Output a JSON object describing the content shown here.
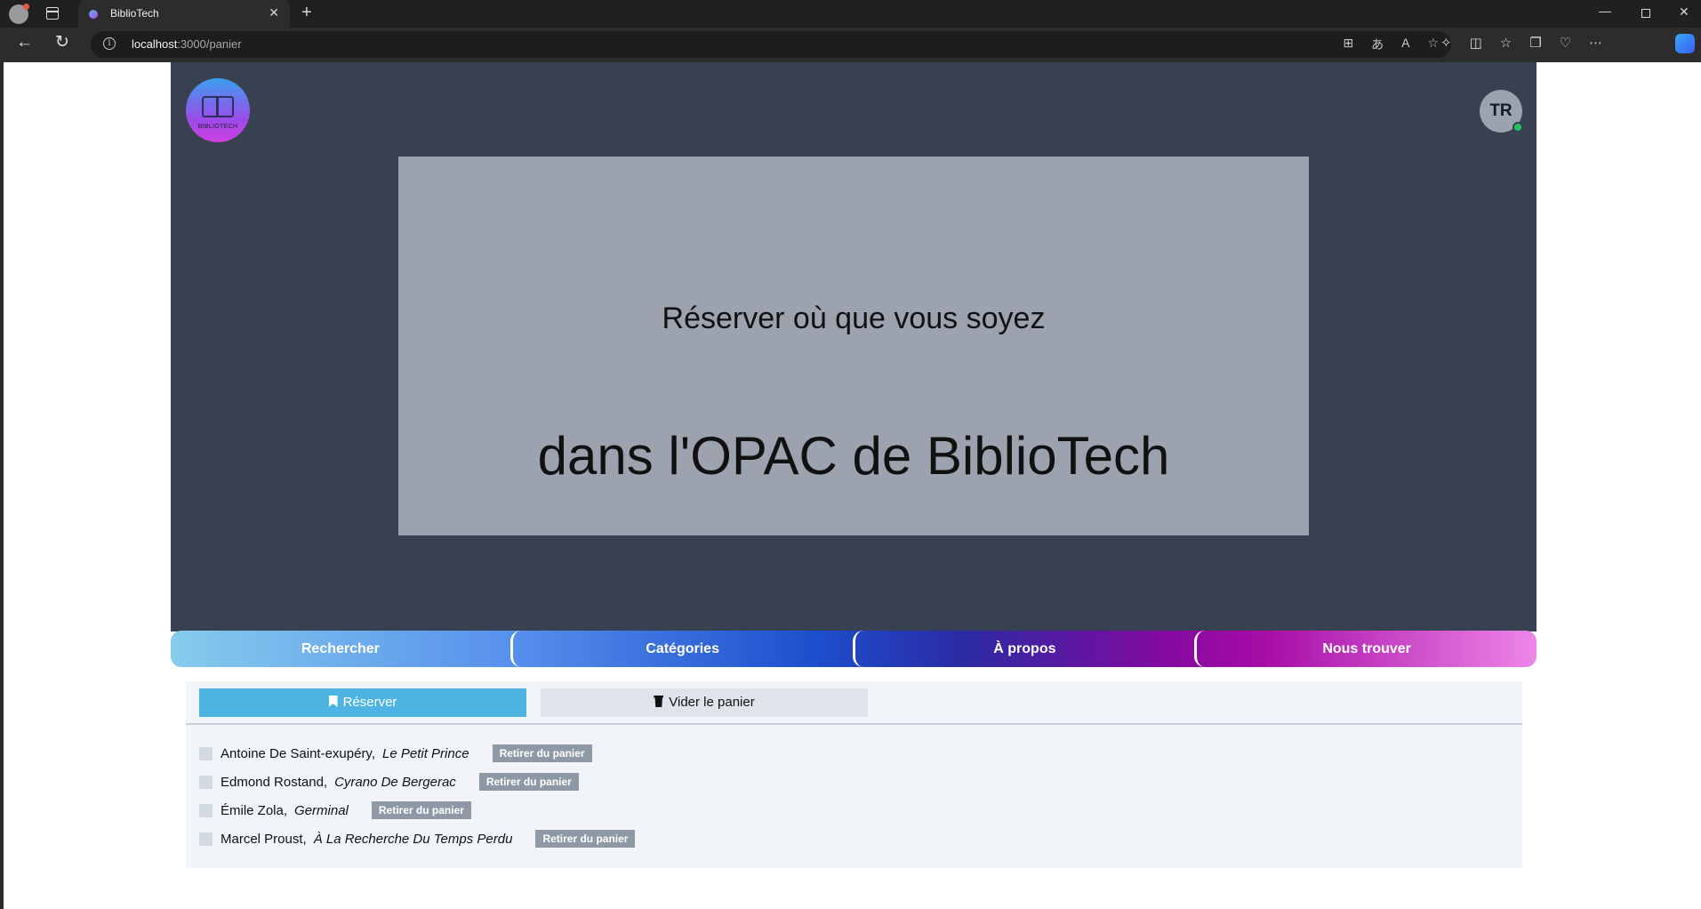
{
  "browser": {
    "tab_title": "BiblioTech",
    "url_host": "localhost",
    "url_path": ":3000/panier"
  },
  "header": {
    "logo_text": "BIBLIOTECH",
    "user_initials": "TR"
  },
  "banner": {
    "line1": "Réserver où que vous soyez",
    "line2": "dans l'OPAC de BiblioTech"
  },
  "menu": [
    {
      "label": "Rechercher"
    },
    {
      "label": "Catégories"
    },
    {
      "label": "À propos"
    },
    {
      "label": "Nous trouver"
    }
  ],
  "cart": {
    "reserve_label": "Réserver",
    "clear_label": "Vider le panier",
    "remove_label": "Retirer du panier",
    "items": [
      {
        "author": "Antoine De Saint-exupéry,",
        "title": "Le Petit Prince"
      },
      {
        "author": "Edmond Rostand,",
        "title": "Cyrano De Bergerac"
      },
      {
        "author": "Émile Zola,",
        "title": "Germinal"
      },
      {
        "author": "Marcel Proust,",
        "title": "À La Recherche Du Temps Perdu"
      }
    ]
  }
}
